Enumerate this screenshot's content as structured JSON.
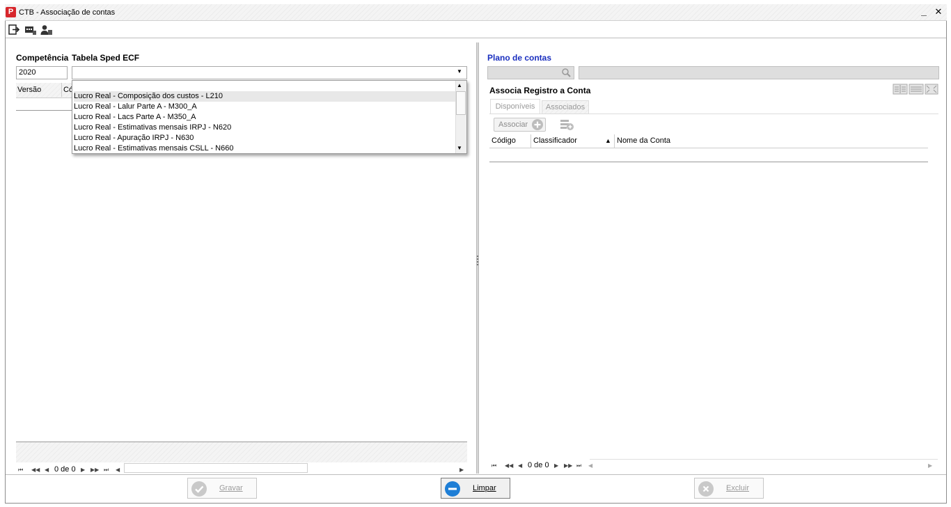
{
  "window": {
    "title": "CTB - Associação de contas",
    "minimize_label": "_",
    "close_label": "✕"
  },
  "app_icon": {
    "icon": "app-logo-icon",
    "glyph": "P",
    "color": "#d7262b"
  },
  "toolbar": {
    "icons": [
      "exit-icon",
      "screen-icon",
      "user-icon"
    ]
  },
  "left": {
    "competencia_label": "Competência",
    "competencia_value": "2020",
    "tabela_label": "Tabela Sped ECF",
    "tabela_value": "",
    "grid_columns": [
      "Versão",
      "Có"
    ],
    "dropdown_items": [
      "Lucro Real - Composição dos custos - L210",
      "Lucro Real - Lalur Parte A - M300_A",
      "Lucro Real - Lacs Parte A - M350_A",
      "Lucro Real - Estimativas mensais IRPJ - N620",
      "Lucro Real - Apuração IRPJ - N630",
      "Lucro Real - Estimativas mensais CSLL - N660"
    ],
    "dropdown_selected_index": 0,
    "pager_text": "0 de 0"
  },
  "right": {
    "plano_label": "Plano de contas",
    "plano_codigo_value": "",
    "plano_nome_value": "",
    "associa_label": "Associa Registro a Conta",
    "tabs": [
      "Disponíveis",
      "Associados"
    ],
    "associar_label": "Associar",
    "grid_columns": [
      "Código",
      "Classificador",
      "Nome da Conta"
    ],
    "sort_column": "Classificador",
    "sort_direction": "ascending",
    "pager_text": "0 de 0"
  },
  "actions": {
    "gravar_label": "Gravar",
    "limpar_label": "Limpar",
    "excluir_label": "Excluir"
  },
  "colors": {
    "accent_blue": "#1a2fbf",
    "brand_red": "#d7262b",
    "limpar_blue": "#1e7ed6"
  }
}
